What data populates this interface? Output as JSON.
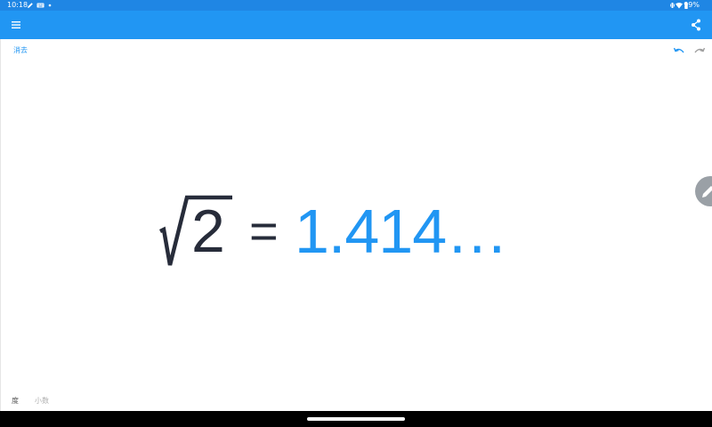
{
  "status_bar": {
    "time": "10:18",
    "battery_percent": "99%",
    "icons": [
      "pen-icon",
      "keyboard-icon",
      "dot-icon",
      "vibrate-icon",
      "wifi-icon",
      "battery-icon"
    ]
  },
  "app_bar": {
    "background": "#2196f3",
    "icons": [
      "menu-icon",
      "share-icon"
    ]
  },
  "toolbar": {
    "clear_label": "消去",
    "icons": [
      "undo-icon",
      "redo-icon"
    ]
  },
  "equation": {
    "radicand": "2",
    "operator": "=",
    "result": "1.414…",
    "expression_color": "#272c3a",
    "result_color": "#2196f3"
  },
  "fab": {
    "icon": "pen-icon"
  },
  "modes": {
    "degree_label": "度",
    "decimal_label": "小数"
  },
  "colors": {
    "status_bar": "#1f86e4",
    "accent": "#2196f3",
    "fab": "#9aa0a6"
  }
}
